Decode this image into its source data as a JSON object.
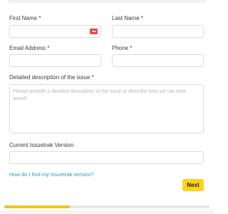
{
  "form": {
    "first_name": {
      "label": "First Name *",
      "value": ""
    },
    "last_name": {
      "label": "Last Name *",
      "value": ""
    },
    "email": {
      "label": "Email Address *",
      "value": ""
    },
    "phone": {
      "label": "Phone *",
      "value": ""
    },
    "description": {
      "label": "Detailed description of the issue *",
      "placeholder": "Please provide a detailed description of the issue or describe how we can best assist!",
      "value": ""
    },
    "version": {
      "label": "Current Issuetrak Version",
      "value": ""
    },
    "help_link": "How do I find my Issuetrak version?",
    "next_label": "Next"
  },
  "progress": {
    "fraction": 0.32
  },
  "colors": {
    "accent": "#ffd21c",
    "link": "#1fa0c7",
    "progress": "#f1c51d",
    "autofill": "#e8474a"
  },
  "icons": {
    "autofill": "password-manager-icon"
  }
}
